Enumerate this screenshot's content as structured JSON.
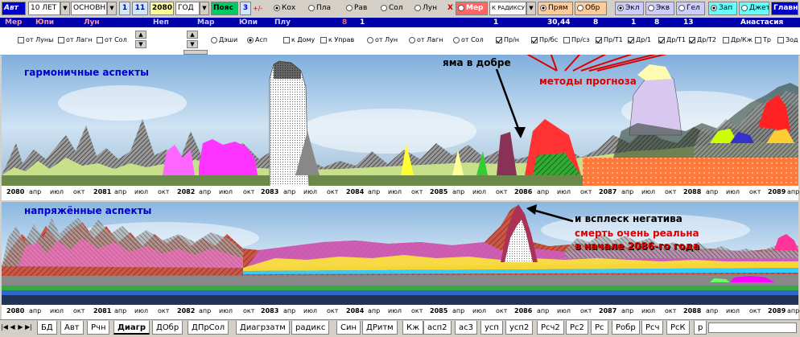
{
  "toolbar": {
    "avt": "Авт",
    "period": "10 ЛЕТ",
    "mode": "ОСНОВН",
    "n1": "1",
    "n2": "11",
    "year": "2080",
    "unit": "ГОД",
    "belt_label": "Пояс",
    "belt_value": "3",
    "plusminus": "+/-",
    "radix": "К РАДИКСУ",
    "planets": [
      "Кох",
      "Пла",
      "Рав",
      "Сол",
      "Лун"
    ],
    "x_label": "Х",
    "mer_label": "Мер",
    "direct": "Прям",
    "reverse": "Обр",
    "ekl": "Экл",
    "ekv": "Экв",
    "gel": "Гел",
    "zap": "Зап",
    "dzhet": "Джет",
    "main": "Главн"
  },
  "planet_row": {
    "labels": [
      "Мер",
      "Юпи",
      "Лун",
      "Неп",
      "Мар",
      "Юпи",
      "Плу"
    ],
    "values": [
      "8",
      "1",
      "1",
      "30,44",
      "8",
      "1",
      "8",
      "13"
    ],
    "name": "Анастасия"
  },
  "controls": {
    "from_moon": "от Луны",
    "from_lagn": "от Лагн",
    "from_sun": "от Сол",
    "dashi": "Дэши",
    "asp": "Асп",
    "to_house": "к Дому",
    "to_upr": "к Управ",
    "from_moon2": "от Лун",
    "from_lagn2": "от Лагн",
    "from_sun2": "от Сол",
    "methods": [
      "Пр/н",
      "Пр/бс",
      "Пр/сз",
      "Пр/Т1",
      "Др/1",
      "Др/Т1",
      "Др/Т2",
      "Др/Кж",
      "Тр",
      "Зод"
    ]
  },
  "chart1": {
    "title": "гармоничные аспекты",
    "note_pit": "яма в добре",
    "note_methods": "методы прогноза"
  },
  "chart2": {
    "title": "напряжённые аспекты",
    "note_burst": "и всплеск негатива",
    "note_death1": "смерть очень реальна",
    "note_death2": "в начале 2086-го года"
  },
  "axis": {
    "ticks": [
      "2080",
      "апр",
      "июл",
      "окт",
      "2081",
      "апр",
      "июл",
      "окт",
      "2082",
      "апр",
      "июл",
      "окт",
      "2083",
      "апр",
      "июл",
      "окт",
      "2084",
      "апр",
      "июл",
      "окт",
      "2085",
      "апр",
      "июл",
      "окт",
      "2086",
      "апр",
      "июл",
      "окт",
      "2087",
      "апр",
      "июл",
      "окт",
      "2088",
      "апр",
      "июл",
      "окт",
      "2089",
      "апр"
    ]
  },
  "tabs": [
    "БД",
    "Авт",
    "Рчн",
    "Диагр",
    "ДОбр",
    "ДПрСол",
    "Диагрзатм",
    "радикс",
    "Син",
    "ДРитм",
    "Кж",
    "асп2",
    "ас3",
    "усп",
    "усп2",
    "Рсч2",
    "Рс2",
    "Рс",
    "Робр",
    "Рсч",
    "РсК",
    "р"
  ],
  "active_tab": "Диагр"
}
